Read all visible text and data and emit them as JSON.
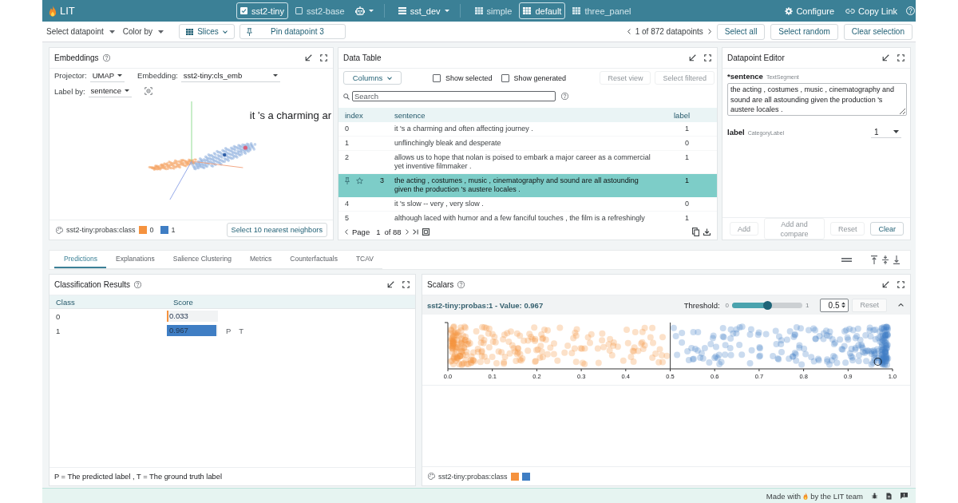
{
  "header": {
    "app_name": "LIT",
    "models": [
      {
        "label": "sst2-tiny",
        "selected": true
      },
      {
        "label": "sst2-base",
        "selected": false
      }
    ],
    "dataset": "sst_dev",
    "layouts": [
      {
        "label": "simple",
        "selected": false
      },
      {
        "label": "default",
        "selected": true
      },
      {
        "label": "three_panel",
        "selected": false
      }
    ],
    "actions": [
      {
        "kind": "settings",
        "label": "Configure"
      },
      {
        "kind": "link",
        "label": "Copy Link"
      }
    ]
  },
  "toolbar": {
    "dropdowns": [
      "Select datapoint",
      "Color by"
    ],
    "slices_button": "Slices",
    "pin_button": "Pin datapoint 3",
    "datapoint_count": "1 of 872 datapoints",
    "buttons": [
      "Select all",
      "Select random",
      "Clear selection"
    ]
  },
  "embeddings": {
    "title": "Embeddings",
    "help": true,
    "controls": [
      {
        "label": "Projector:",
        "value": "UMAP"
      },
      {
        "label": "Embedding:",
        "value": "sst2-tiny:cls_emb"
      },
      {
        "label": "Label by:",
        "value": "sentence"
      }
    ],
    "point_label": "it 's a charming ar",
    "legend": {
      "field": "sst2-tiny:probas:class",
      "items": [
        {
          "label": "0",
          "color": "#f5923e"
        },
        {
          "label": "1",
          "color": "#3f7ec4"
        }
      ]
    },
    "neighbors_button": "Select 10 nearest neighbors"
  },
  "data_table": {
    "title": "Data Table",
    "columns_button": "Columns",
    "toggles": [
      {
        "label": "Show selected",
        "checked": false
      },
      {
        "label": "Show generated",
        "checked": false
      }
    ],
    "buttons": [
      {
        "label": "Reset view",
        "disabled": true
      },
      {
        "label": "Select filtered",
        "disabled": true
      }
    ],
    "search": {
      "placeholder": "Search"
    },
    "columns": [
      "index",
      "sentence",
      "label"
    ],
    "rows": [
      {
        "index": "0",
        "sentence": "it 's a charming and often affecting journey .",
        "label": "1",
        "selected": false
      },
      {
        "index": "1",
        "sentence": "unflinchingly bleak and desperate",
        "label": "0",
        "selected": false
      },
      {
        "index": "2",
        "sentence": "allows us to hope that nolan is poised to embark a major career as a commercial yet inventive filmmaker .",
        "label": "1",
        "selected": false
      },
      {
        "index": "3",
        "sentence": "the acting , costumes , music , cinematography and sound are all astounding given the production 's austere locales .",
        "label": "1",
        "selected": true
      },
      {
        "index": "4",
        "sentence": "it 's slow -- very , very slow .",
        "label": "0",
        "selected": false
      },
      {
        "index": "5",
        "sentence": "although laced with humor and a few fanciful touches , the film is a refreshingly",
        "label": "1",
        "selected": false
      }
    ],
    "pagination": {
      "page_label": "Page",
      "page": "1",
      "page_count": "of 88"
    }
  },
  "datapoint_editor": {
    "title": "Datapoint Editor",
    "fields": [
      {
        "kind": "text",
        "name": "*sentence",
        "type": "TextSegment",
        "value": "the acting , costumes , music , cinematography and sound are all astounding given the production 's austere locales ."
      },
      {
        "kind": "select",
        "name": "label",
        "type": "CategoryLabel",
        "value": "1"
      }
    ],
    "buttons": [
      {
        "label": "Add",
        "disabled": true
      },
      {
        "label": "Add and compare",
        "disabled": true
      },
      {
        "label": "Reset",
        "disabled": true
      },
      {
        "label": "Clear",
        "disabled": false
      }
    ]
  },
  "module_tabs": [
    {
      "label": "Predictions",
      "selected": true
    },
    {
      "label": "Explanations",
      "selected": false
    },
    {
      "label": "Salience Clustering",
      "selected": false
    },
    {
      "label": "Metrics",
      "selected": false
    },
    {
      "label": "Counterfactuals",
      "selected": false
    },
    {
      "label": "TCAV",
      "selected": false
    }
  ],
  "classification": {
    "title": "Classification Results",
    "help": true,
    "columns": [
      "Class",
      "Score"
    ],
    "rows": [
      {
        "class": "0",
        "score": "0.033",
        "level": 0.033,
        "color": "#f5923e"
      },
      {
        "class": "1",
        "score": "0.967",
        "level": 0.967,
        "color": "#3f7ec4",
        "markers": [
          "P",
          "T"
        ]
      }
    ],
    "footnote": "P = The predicted label , T = The ground truth label"
  },
  "scalars": {
    "title": "Scalars",
    "help": true,
    "plot_title": "sst2-tiny:probas:1 - Value: 0.967",
    "threshold": {
      "label": "Threshold:",
      "min": "0",
      "max": "1",
      "level": 0.5,
      "value": "0.5"
    },
    "reset_button": {
      "label": "Reset",
      "disabled": true
    },
    "expanded": true,
    "axis_ticks": [
      "0.0",
      "0.1",
      "0.2",
      "0.3",
      "0.4",
      "0.5",
      "0.6",
      "0.7",
      "0.8",
      "0.9",
      "1.0"
    ],
    "legend": {
      "field": "sst2-tiny:probas:class",
      "items": [
        {
          "color": "#f5923e"
        },
        {
          "color": "#3f7ec4"
        }
      ]
    }
  },
  "footer": {
    "text_before": "Made with",
    "text_after": "by the LIT team"
  }
}
